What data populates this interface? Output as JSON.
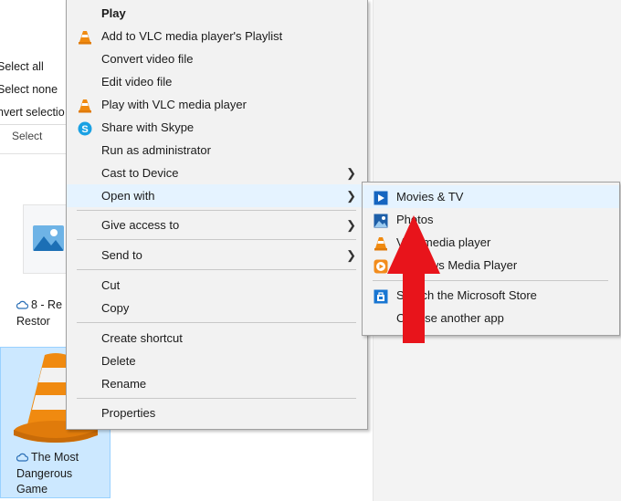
{
  "ribbon": {
    "items": [
      "Select all",
      "Select none",
      "nvert selectio"
    ],
    "group_label": "Select"
  },
  "files": [
    {
      "name": "8 - Re",
      "name_line2": "Restor",
      "icon": "image-file-icon"
    },
    {
      "name": "The Most",
      "name_line2": "Dangerous",
      "name_line3": "Game",
      "icon": "vlc-cone-icon"
    }
  ],
  "context_menu": {
    "items": [
      {
        "label": "Play",
        "bold": true
      },
      {
        "label": "Add to VLC media player's Playlist",
        "icon": "vlc-icon"
      },
      {
        "label": "Convert video file"
      },
      {
        "label": "Edit video file"
      },
      {
        "label": "Play with VLC media player",
        "icon": "vlc-icon"
      },
      {
        "label": "Share with Skype",
        "icon": "skype-icon"
      },
      {
        "label": "Run as administrator"
      },
      {
        "label": "Cast to Device",
        "submenu": true
      },
      {
        "label": "Open with",
        "submenu": true,
        "highlighted": true
      },
      {
        "label": "Give access to",
        "submenu": true
      },
      {
        "label": "Send to",
        "submenu": true
      },
      {
        "label": "Cut"
      },
      {
        "label": "Copy"
      },
      {
        "label": "Create shortcut"
      },
      {
        "label": "Delete"
      },
      {
        "label": "Rename"
      },
      {
        "label": "Properties"
      }
    ]
  },
  "open_with_menu": {
    "items": [
      {
        "label": "Movies & TV",
        "icon": "movies-tv-icon",
        "highlighted": true
      },
      {
        "label": "Photos",
        "icon": "photos-icon"
      },
      {
        "label": "VLC media player",
        "icon": "vlc-icon"
      },
      {
        "label": "Windows Media Player",
        "icon": "windows-media-player-icon"
      },
      {
        "label": "Search the Microsoft Store",
        "icon": "microsoft-store-icon"
      },
      {
        "label": "Choose another app"
      }
    ]
  },
  "colors": {
    "menu_bg": "#f2f2f2",
    "highlight": "#e5f3ff",
    "selection": "#cce8ff",
    "annotation_arrow": "#e8141b"
  }
}
